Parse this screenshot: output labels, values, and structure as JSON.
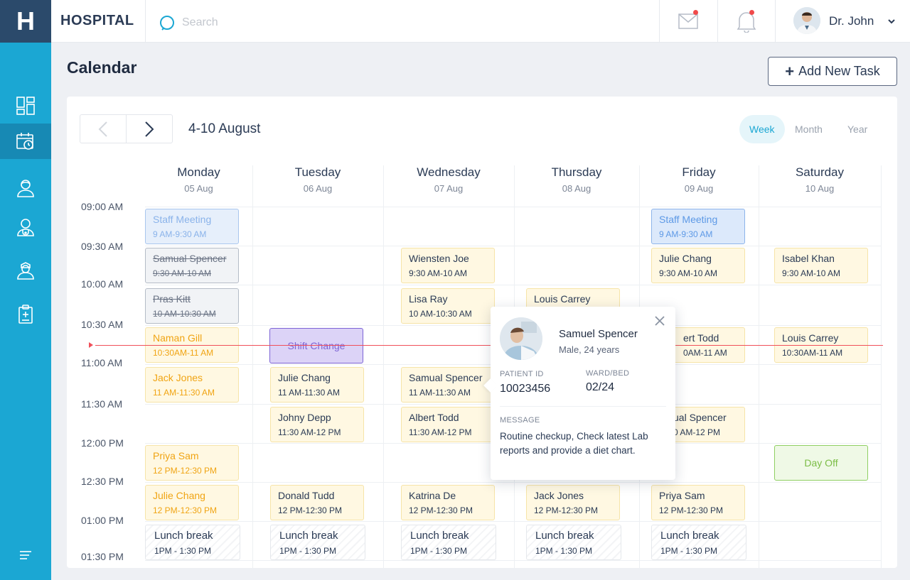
{
  "app": {
    "logo": "H",
    "brand": "HOSPITAL"
  },
  "search": {
    "placeholder": "Search"
  },
  "user": {
    "name": "Dr. John"
  },
  "page": {
    "title": "Calendar",
    "add_task_label": "Add New Task"
  },
  "calendar": {
    "range": "4-10 August",
    "views": [
      "Week",
      "Month",
      "Year"
    ],
    "active_view": "Week",
    "days": [
      {
        "name": "Monday",
        "date": "05 Aug"
      },
      {
        "name": "Tuesday",
        "date": "06 Aug"
      },
      {
        "name": "Wednesday",
        "date": "07 Aug"
      },
      {
        "name": "Thursday",
        "date": "08 Aug"
      },
      {
        "name": "Friday",
        "date": "09 Aug"
      },
      {
        "name": "Saturday",
        "date": "10 Aug"
      }
    ],
    "times": [
      "09:00 AM",
      "09:30 AM",
      "10:00 AM",
      "10:30 AM",
      "11:00 AM",
      "11:30 AM",
      "12:00 PM",
      "12:30 PM",
      "01:00 PM",
      "01:30 PM"
    ],
    "events": [
      {
        "title": "Staff Meeting",
        "time": "9 AM-9:30 AM",
        "style": "blue faded"
      },
      {
        "title": "Samual Spencer",
        "time": "9:30 AM-10 AM",
        "style": "grey"
      },
      {
        "title": "Pras Kitt",
        "time": "10 AM-10:30 AM",
        "style": "grey"
      },
      {
        "title": "Naman Gill",
        "time": "10:30AM-11 AM",
        "style": "orange"
      },
      {
        "title": "Jack Jones",
        "time": "11 AM-11:30 AM",
        "style": "orange"
      },
      {
        "title": "Priya Sam",
        "time": "12 PM-12:30 PM",
        "style": "orange"
      },
      {
        "title": "Julie Chang",
        "time": "12 PM-12:30 PM",
        "style": "orange"
      },
      {
        "title": "Lunch break",
        "time": "1PM - 1:30 PM",
        "style": "lunch"
      },
      {
        "title": "Shift Change",
        "time": "",
        "style": "purple"
      },
      {
        "title": "Julie Chang",
        "time": "11 AM-11:30 AM",
        "style": "yellow"
      },
      {
        "title": "Johny Depp",
        "time": "11:30 AM-12 PM",
        "style": "yellow"
      },
      {
        "title": "Donald Tudd",
        "time": "12 PM-12:30 PM",
        "style": "yellow"
      },
      {
        "title": "Lunch break",
        "time": "1PM - 1:30 PM",
        "style": "lunch"
      },
      {
        "title": "Wiensten Joe",
        "time": "9:30 AM-10 AM",
        "style": "yellow"
      },
      {
        "title": "Lisa Ray",
        "time": "10 AM-10:30 AM",
        "style": "yellow"
      },
      {
        "title": "Samual Spencer",
        "time": "11 AM-11:30 AM",
        "style": "yellow"
      },
      {
        "title": "Albert Todd",
        "time": "11:30 AM-12 PM",
        "style": "yellow"
      },
      {
        "title": "Katrina De",
        "time": "12 PM-12:30 PM",
        "style": "yellow"
      },
      {
        "title": "Lunch break",
        "time": "1PM - 1:30 PM",
        "style": "lunch"
      },
      {
        "title": "Louis Carrey",
        "time": "",
        "style": "yellow"
      },
      {
        "title": "Jack Jones",
        "time": "12 PM-12:30 PM",
        "style": "yellow"
      },
      {
        "title": "Lunch break",
        "time": "1PM - 1:30 PM",
        "style": "lunch"
      },
      {
        "title": "Staff Meeting",
        "time": "9 AM-9:30 AM",
        "style": "blue"
      },
      {
        "title": "Julie Chang",
        "time": "9:30 AM-10 AM",
        "style": "yellow"
      },
      {
        "title": "ert Todd",
        "time": "0AM-11 AM",
        "style": "yellow"
      },
      {
        "title": "ual Spencer",
        "time": "0 AM-12 PM",
        "style": "yellow"
      },
      {
        "title": "Priya Sam",
        "time": "12 PM-12:30 PM",
        "style": "yellow"
      },
      {
        "title": "Lunch break",
        "time": "1PM - 1:30 PM",
        "style": "lunch"
      },
      {
        "title": "Isabel Khan",
        "time": "9:30 AM-10 AM",
        "style": "yellow"
      },
      {
        "title": "Louis Carrey",
        "time": "10:30AM-11 AM",
        "style": "yellow"
      },
      {
        "title": "Day Off",
        "time": "",
        "style": "green"
      }
    ]
  },
  "popover": {
    "name": "Samuel Spencer",
    "subtitle": "Male, 24 years",
    "patient_id_label": "PATIENT ID",
    "patient_id": "10023456",
    "ward_label": "WARD/BED",
    "ward": "02/24",
    "message_label": "MESSAGE",
    "message": "Routine checkup, Check latest Lab reports and provide a diet chart."
  }
}
